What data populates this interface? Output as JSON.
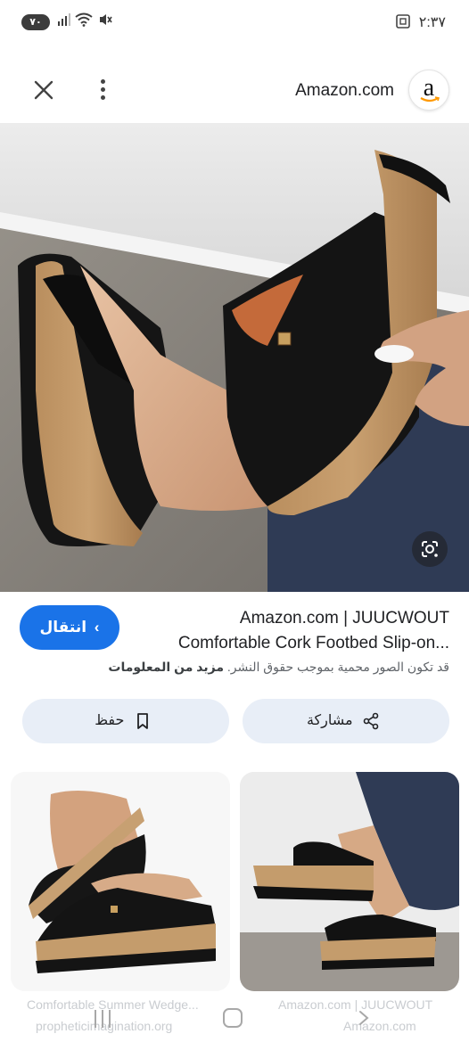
{
  "status_bar": {
    "battery": "٧٠",
    "time": "٢:٣٧"
  },
  "header": {
    "site_name": "Amazon.com",
    "logo_letter": "a"
  },
  "result": {
    "visit_label": "انتقال",
    "title_line1": "Amazon.com | JUUCWOUT",
    "title_line2": "Comfortable Cork Footbed Slip-on...",
    "copyright_text": "قد تكون الصور محمية بموجب حقوق النشر.",
    "more_info": "مزيد من المعلومات"
  },
  "actions": {
    "share_label": "مشاركة",
    "save_label": "حفظ"
  },
  "related": [
    {
      "title": "Comfortable Summer Wedge...",
      "source": "propheticimagination.org"
    },
    {
      "title": "Amazon.com | JUUCWOUT",
      "source": "Amazon.com"
    }
  ],
  "icons": {
    "close": "close-icon",
    "more": "more-vert-icon",
    "lens": "lens-icon",
    "share": "share-icon",
    "save": "bookmark-icon"
  },
  "colors": {
    "accent": "#1a73e8",
    "action_bg": "#e8eef7"
  }
}
